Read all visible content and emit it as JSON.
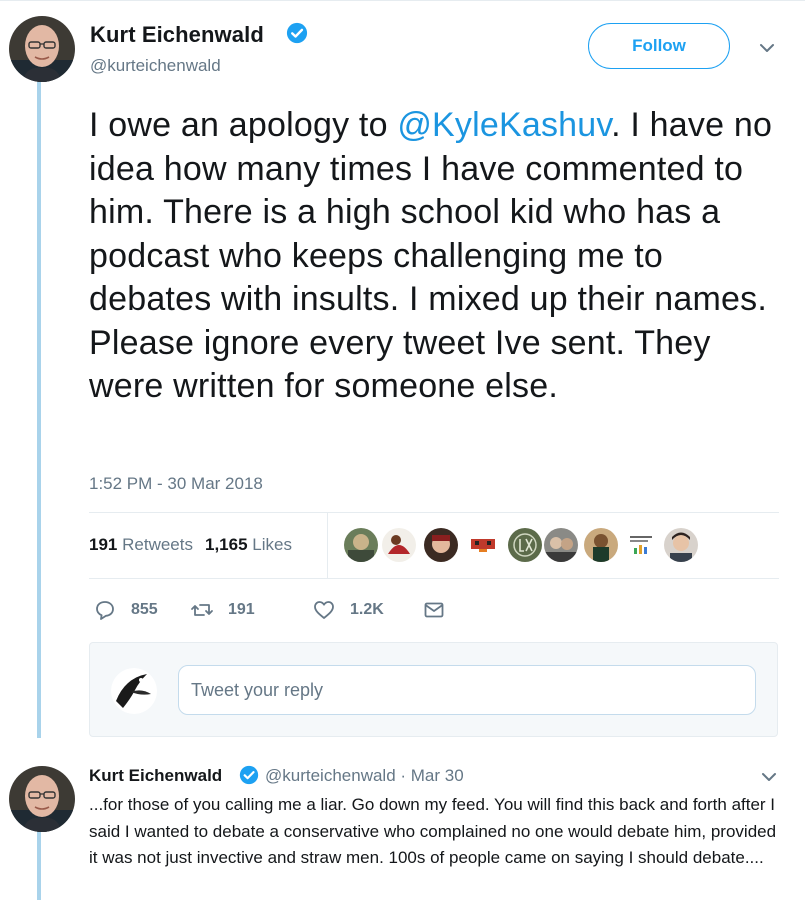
{
  "tweet": {
    "author_name": "Kurt Eichenwald",
    "author_handle": "@kurteichenwald",
    "follow_label": "Follow",
    "text_before_mention": "I owe an apology to ",
    "mention": "@KyleKashuv",
    "text_after_mention": ". I have no idea how many times I have commented to him. There is a high school kid who has a podcast who keeps challenging me to debates with insults. I mixed up their names. Please ignore every tweet Ive sent. They were written for someone else.",
    "timestamp": "1:52 PM - 30 Mar 2018"
  },
  "stats": {
    "retweets_count": "191",
    "retweets_label": "Retweets",
    "likes_count": "1,165",
    "likes_label": "Likes"
  },
  "actions": {
    "reply_count": "855",
    "retweet_count": "191",
    "like_count": "1.2K"
  },
  "reply_composer": {
    "placeholder": "Tweet your reply"
  },
  "reply_tweet": {
    "author_name": "Kurt Eichenwald",
    "author_handle": "@kurteichenwald",
    "date": "· Mar 30",
    "text": "...for those of you calling me a liar. Go down my feed. You will find this back and forth after I said I wanted to debate a conservative who complained no one would debate him, provided it was not just invective and straw men. 100s of people came on saying I should debate...."
  },
  "colors": {
    "accent": "#1da1f2",
    "mention": "#1b95e0",
    "secondary_text": "#657786",
    "thread_line": "#a9d3eb"
  }
}
